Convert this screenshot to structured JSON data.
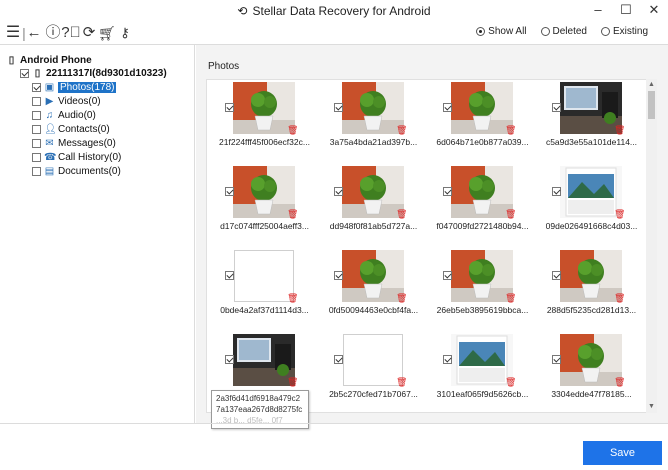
{
  "window": {
    "title": "Stellar Data Recovery for Android",
    "title_icon": "undo-arrow-icon",
    "minimize": "–",
    "maximize": "☐",
    "close": "✕"
  },
  "toolbar": {
    "icons": [
      "menu-icon",
      "back-icon",
      "info-icon",
      "help-icon",
      "refresh-icon",
      "cart-icon",
      "key-icon"
    ]
  },
  "filters": {
    "options": [
      "Show All",
      "Deleted",
      "Existing"
    ],
    "selected": "Show All"
  },
  "tree": {
    "root": "Android Phone",
    "device": "22111317I(8d9301d10323)",
    "items": [
      {
        "label": "Photos(178)",
        "icon": "photo-icon",
        "checked": true,
        "selected": true
      },
      {
        "label": "Videos(0)",
        "icon": "video-icon",
        "checked": false
      },
      {
        "label": "Audio(0)",
        "icon": "audio-icon",
        "checked": false
      },
      {
        "label": "Contacts(0)",
        "icon": "contacts-icon",
        "checked": false
      },
      {
        "label": "Messages(0)",
        "icon": "messages-icon",
        "checked": false
      },
      {
        "label": "Call History(0)",
        "icon": "phone-icon",
        "checked": false
      },
      {
        "label": "Documents(0)",
        "icon": "documents-icon",
        "checked": false
      }
    ]
  },
  "photos": {
    "title": "Photos",
    "items": [
      {
        "caption": "21f224fff45f006ecf32c...",
        "thumb": "plant"
      },
      {
        "caption": "3a75a4bda21ad397b...",
        "thumb": "plant"
      },
      {
        "caption": "6d064b71e0b877a039...",
        "thumb": "plant"
      },
      {
        "caption": "c5a9d3e55a101de114...",
        "thumb": "desk"
      },
      {
        "caption": "d17c074fff25004aeff3...",
        "thumb": "plant"
      },
      {
        "caption": "dd948f0f81ab5d727a...",
        "thumb": "plant"
      },
      {
        "caption": "f047009fd2721480b94...",
        "thumb": "plant"
      },
      {
        "caption": "09de026491668c4d03...",
        "thumb": "calendar"
      },
      {
        "caption": "0bde4a2af37d1114d3...",
        "thumb": "blank"
      },
      {
        "caption": "0fd50094463e0cbf4fa...",
        "thumb": "plant"
      },
      {
        "caption": "26eb5eb3895619bbca...",
        "thumb": "plant"
      },
      {
        "caption": "288d5f5235cd281d13...",
        "thumb": "plant"
      },
      {
        "caption": "",
        "thumb": "desk"
      },
      {
        "caption": "2b5c270cfed71b7067...",
        "thumb": "blank"
      },
      {
        "caption": "3101eaf065f9d5626cb...",
        "thumb": "calendar"
      },
      {
        "caption": "3304edde47f78185...",
        "thumb": "plant"
      }
    ]
  },
  "tooltip": {
    "line1": "2a3f6d41df6918a479c2",
    "line2": "7a137eaa267d8d8275fc",
    "line3": "...3d b... d5fe... 0f7"
  },
  "footer": {
    "save_label": "Save"
  },
  "colors": {
    "accent": "#1e73e8",
    "selection": "#1e73c8",
    "wall": "#c8502a",
    "pot": "#f2f2f2",
    "leaf": "#3f7f20",
    "delete": "#dd2222"
  }
}
